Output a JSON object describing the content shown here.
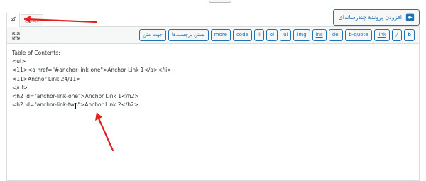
{
  "add_media": {
    "label": "افزودن پروندهٔ چندرسانه‌ای"
  },
  "tabs": {
    "code": "کد",
    "visual": "دیداری"
  },
  "toolbar": {
    "buttons": [
      "b",
      "/",
      "link",
      "b-quote",
      "del",
      "ins",
      "img",
      "ul",
      "ol",
      "li",
      "code",
      "more",
      "بستن برچسب‌ها",
      "جهت متن"
    ]
  },
  "editor": {
    "content": "Table of Contents:\n<ul>\n<11><a href=\"#anchor-link-one\">Anchor Link 1</a></li>\n<11>Anchor Link 24/11>\n</ul>\n<h2 id=\"anchor-link-one\">Anchor Link 1</h2>\n<h2 id=\"anchor-link-two\">Anchor Link 2</h2>"
  },
  "icons": {
    "fullscreen": "fullscreen-icon",
    "media": "media-icon"
  },
  "colors": {
    "accent": "#2271b1",
    "border": "#dcdcde",
    "toolbar": "#f6f7f7",
    "annotation": "#e3201b"
  }
}
